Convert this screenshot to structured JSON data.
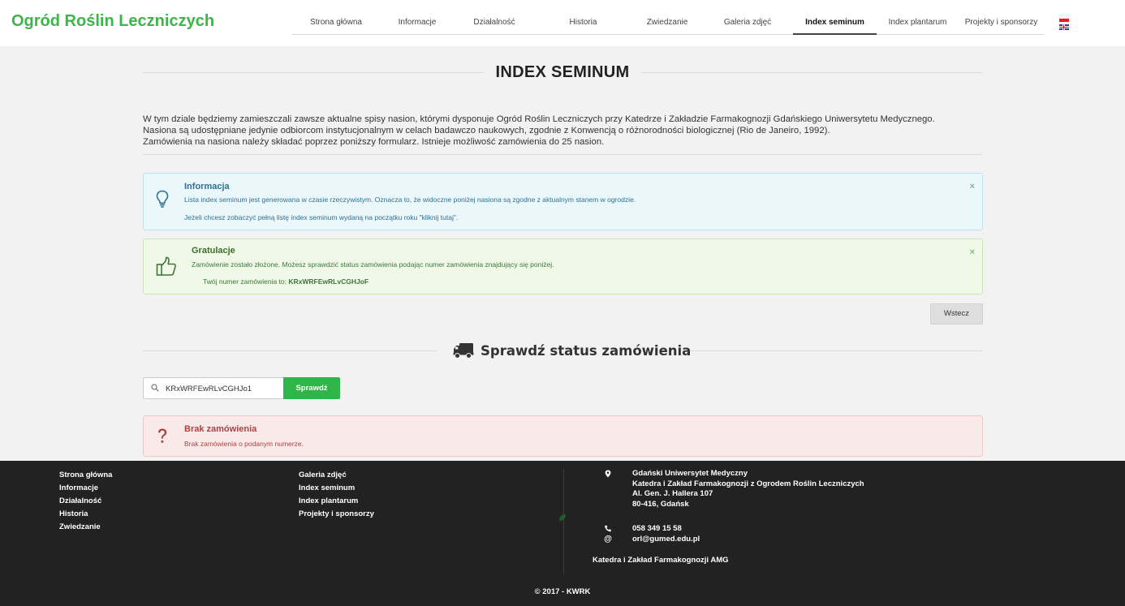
{
  "header": {
    "brand": "Ogród Roślin Leczniczych",
    "nav": [
      {
        "label": "Strona główna",
        "active": false
      },
      {
        "label": "Informacje",
        "active": false
      },
      {
        "label": "Działalność",
        "active": false
      },
      {
        "label": "Historia",
        "active": false
      },
      {
        "label": "Zwiedzanie",
        "active": false
      },
      {
        "label": "Galeria zdjęć",
        "active": false
      },
      {
        "label": "Index seminum",
        "active": true
      },
      {
        "label": "Index plantarum",
        "active": false
      },
      {
        "label": "Projekty i sponsorzy",
        "active": false
      }
    ],
    "languages": [
      "pl-flag-icon",
      "uk-flag-icon"
    ]
  },
  "page": {
    "title": "INDEX SEMINUM",
    "intro": [
      "W tym dziale będziemy zamieszczali zawsze aktualne spisy nasion, którymi dysponuje Ogród Roślin Leczniczych przy Katedrze i Zakładzie Farmakognozji Gdańskiego Uniwersytetu Medycznego.",
      "Nasiona są udostępniane jedynie odbiorcom instytucjonalnym w celach badawczo naukowych, zgodnie z Konwencją o różnorodności biologicznej (Rio de Janeiro, 1992).",
      "Zamówienia na nasiona należy składać poprzez poniższy formularz. Istnieje możliwość zamówienia do 25 nasion."
    ]
  },
  "alerts": {
    "info": {
      "icon": "lightbulb-icon",
      "title": "Informacja",
      "line1": "Lista index seminum jest generowana w czasie rzeczywistym. Oznacza to, że widoczne poniżej nasiona są zgodne z aktualnym stanem w ogrodzie.",
      "line2": "Jeżeli chcesz zobaczyć pełną listę index seminum wydaną na początku roku \"kliknij tutaj\".",
      "close": "×"
    },
    "success": {
      "icon": "thumbs-up-icon",
      "title": "Gratulacje",
      "line1": "Zamówienie zostało złożone. Możesz sprawdzić status zamówienia podając numer zamówienia znajdujący się poniżej.",
      "order_prefix": "Twój numer zamówienia to:",
      "order_number": "KRxWRFEwRLvCGHJoF",
      "close": "×"
    },
    "danger": {
      "icon": "question-mark-icon",
      "title": "Brak zamówienia",
      "line1": "Brak zamówienia o podanym numerze."
    }
  },
  "buttons": {
    "back": "Wstecz",
    "check": "Sprawdź"
  },
  "status": {
    "icon": "truck-icon",
    "title": "Sprawdź status zamówienia",
    "search_icon": "search-icon",
    "search_value": "KRxWRFEwRLvCGHJo1"
  },
  "footer": {
    "col1": [
      "Strona główna",
      "Informacje",
      "Działalność",
      "Historia",
      "Zwiedzanie"
    ],
    "col2": [
      "Galeria zdjęć",
      "Index seminum",
      "Index plantarum",
      "Projekty i sponsorzy"
    ],
    "address": [
      "Gdański Uniwersytet Medyczny",
      "Katedra i Zakład Farmakognozji z Ogrodem Roślin Leczniczych",
      "Al. Gen. J. Hallera 107",
      "80-416, Gdańsk"
    ],
    "address_icon": "map-marker-icon",
    "phone_icon": "phone-icon",
    "phone": "058 349 15 58",
    "email_icon": "at-icon",
    "email": "orl@gumed.edu.pl",
    "department": "Katedra i Zakład Farmakognozji AMG",
    "copyright": "© 2017 - KWRK"
  }
}
